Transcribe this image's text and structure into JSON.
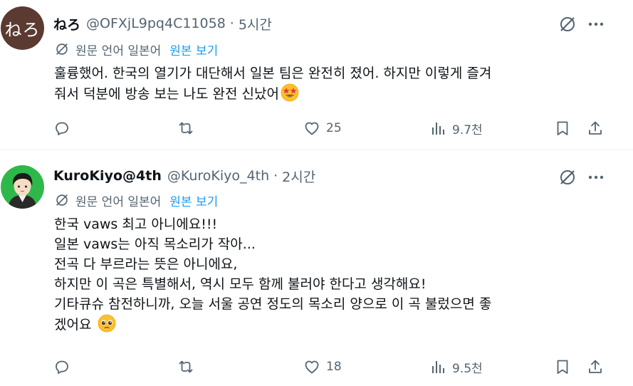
{
  "tweets": [
    {
      "avatar_text": "ねろ",
      "display_name": "ねろ",
      "handle": "@OFXjL9pq4C11058",
      "separator": "·",
      "time": "5시간",
      "translate": {
        "label": "원문 언어 일본어",
        "show_original": "원본 보기"
      },
      "body": "훌륭했어. 한국의 열기가 대단해서 일본 팀은 완전히 졌어. 하지만 이렇게 즐겨\n줘서 덕분에 방송 보는 나도 완전 신났어",
      "body_emoji": "star-struck-emoji",
      "likes": "25",
      "views": "9.7천"
    },
    {
      "display_name": "KuroKiyo@4th",
      "handle": "@KuroKiyo_4th",
      "separator": "·",
      "time": "2시간",
      "translate": {
        "label": "원문 언어 일본어",
        "show_original": "원본 보기"
      },
      "body": "한국 vaws 최고 아니에요!!!\n일본 vaws는 아직 목소리가 작아...\n전곡 다 부르라는 뜻은 아니에요,\n하지만 이 곡은 특별해서, 역시 모두 함께 불러야 한다고 생각해요!\n기타큐슈 참전하니까, 오늘 서울 공연 정도의 목소리 양으로 이 곡 불렀으면 좋\n겠어요",
      "body_emoji": "pleading-face-emoji",
      "likes": "18",
      "views": "9.5천"
    }
  ],
  "colors": {
    "text_primary": "#0f1419",
    "text_secondary": "#536471",
    "link_blue": "#1d9bf0",
    "divider": "#eff3f4"
  }
}
